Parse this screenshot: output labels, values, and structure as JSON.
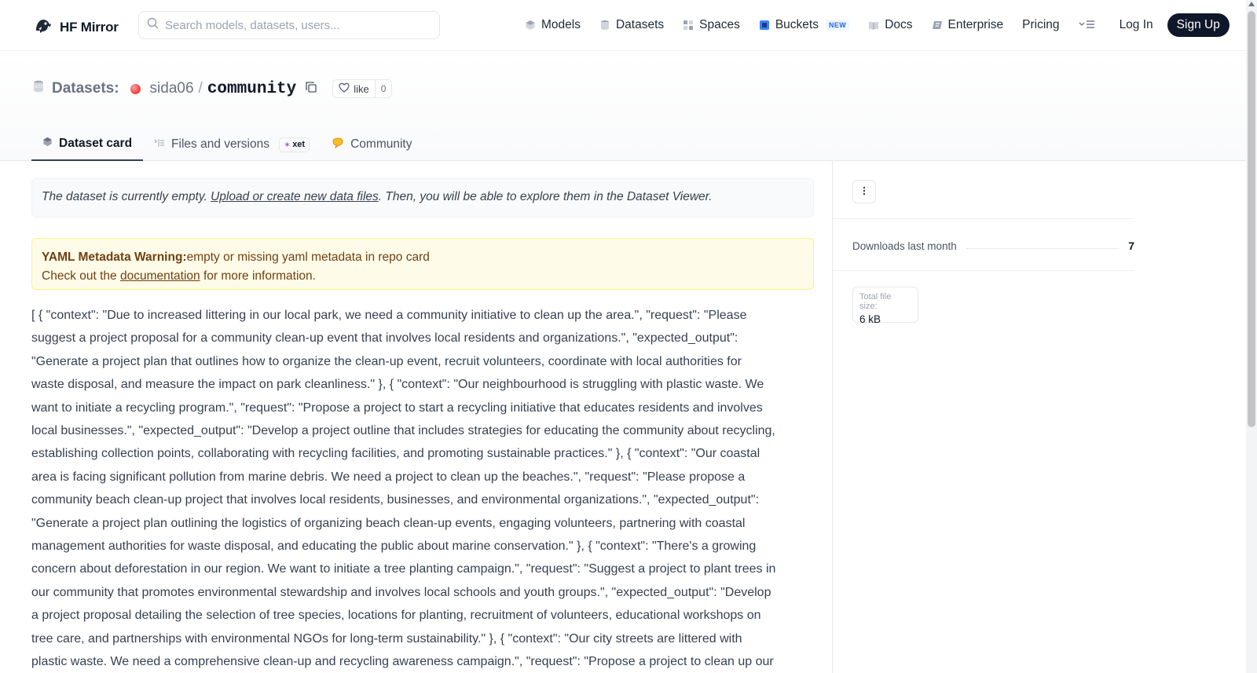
{
  "nav": {
    "brand": "HF Mirror",
    "search_placeholder": "Search models, datasets, users...",
    "links": {
      "models": "Models",
      "datasets": "Datasets",
      "spaces": "Spaces",
      "buckets": "Buckets",
      "buckets_badge": "NEW",
      "docs": "Docs",
      "enterprise": "Enterprise",
      "pricing": "Pricing"
    },
    "login": "Log In",
    "signup": "Sign Up"
  },
  "repo": {
    "type_label": "Datasets:",
    "owner": "sida06",
    "separator": "/",
    "name": "community",
    "like_label": "like",
    "like_count": "0"
  },
  "tabs": {
    "dataset_card": "Dataset card",
    "files": "Files and versions",
    "files_badge": "xet",
    "community": "Community"
  },
  "notice": {
    "prefix": "The dataset is currently empty. ",
    "link": "Upload or create new data files",
    "suffix": ". Then, you will be able to explore them in the Dataset Viewer."
  },
  "warning": {
    "title": "YAML Metadata Warning:",
    "message": "empty or missing yaml metadata in repo card",
    "line2_prefix": "Check out the ",
    "line2_link": "documentation",
    "line2_suffix": " for more information."
  },
  "content_text": "[ { \"context\": \"Due to increased littering in our local park, we need a community initiative to clean up the area.\", \"request\": \"Please suggest a project proposal for a community clean-up event that involves local residents and organizations.\", \"expected_output\": \"Generate a project plan that outlines how to organize the clean-up event, recruit volunteers, coordinate with local authorities for waste disposal, and measure the impact on park cleanliness.\" }, { \"context\": \"Our neighbourhood is struggling with plastic waste. We want to initiate a recycling program.\", \"request\": \"Propose a project to start a recycling initiative that educates residents and involves local businesses.\", \"expected_output\": \"Develop a project outline that includes strategies for educating the community about recycling, establishing collection points, collaborating with recycling facilities, and promoting sustainable practices.\" }, { \"context\": \"Our coastal area is facing significant pollution from marine debris. We need a project to clean up the beaches.\", \"request\": \"Please propose a community beach clean-up project that involves local residents, businesses, and environmental organizations.\", \"expected_output\": \"Generate a project plan outlining the logistics of organizing beach clean-up events, engaging volunteers, partnering with coastal management authorities for waste disposal, and educating the public about marine conservation.\" }, { \"context\": \"There's a growing concern about deforestation in our region. We want to initiate a tree planting campaign.\", \"request\": \"Suggest a project to plant trees in our community that promotes environmental stewardship and involves local schools and youth groups.\", \"expected_output\": \"Develop a project proposal detailing the selection of tree species, locations for planting, recruitment of volunteers, educational workshops on tree care, and partnerships with environmental NGOs for long-term sustainability.\" }, { \"context\": \"Our city streets are littered with plastic waste. We need a comprehensive clean-up and recycling awareness campaign.\", \"request\": \"Propose a project to clean up our",
  "sidebar": {
    "downloads_label": "Downloads last month",
    "downloads_value": "7",
    "size_label": "Total file size:",
    "size_value": "6 kB"
  }
}
